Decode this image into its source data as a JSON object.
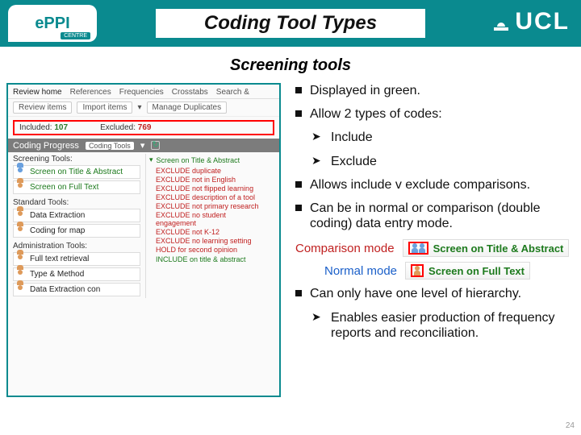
{
  "header": {
    "logo_text": "ePPI",
    "logo_sub": "CENTRE",
    "title": "Coding Tool Types",
    "ucl": "UCL"
  },
  "subtitle": "Screening tools",
  "screenshot": {
    "tabs": [
      "Review home",
      "References",
      "Frequencies",
      "Crosstabs",
      "Search &"
    ],
    "row2": {
      "t1": "Review items",
      "t2": "Import items",
      "t3": "Manage Duplicates"
    },
    "highlight": {
      "inc_label": "Included:",
      "inc_n": "107",
      "exc_label": "Excluded:",
      "exc_n": "769"
    },
    "section": {
      "title": "Coding Progress",
      "pill": "Coding Tools"
    },
    "groups": {
      "screening_label": "Screening Tools:",
      "screening": [
        "Screen on Title & Abstract",
        "Screen on Full Text"
      ],
      "standard_label": "Standard Tools:",
      "standard": [
        "Data Extraction",
        "Coding for map"
      ],
      "admin_label": "Administration Tools:",
      "admin": [
        "Full text retrieval",
        "Type & Method",
        "Data Extraction con"
      ]
    },
    "rightpanel": {
      "header": "Screen on Title & Abstract",
      "lines": [
        "EXCLUDE duplicate",
        "EXCLUDE not in English",
        "EXCLUDE not flipped learning",
        "EXCLUDE description of a tool",
        "EXCLUDE not primary research",
        "EXCLUDE no student engagement",
        "EXCLUDE not K-12",
        "EXCLUDE no learning setting",
        "HOLD for second opinion"
      ],
      "include_line": "INCLUDE on title & abstract"
    }
  },
  "points": {
    "p1": "Displayed in green.",
    "p2": "Allow 2 types of codes:",
    "p2a": "Include",
    "p2b": "Exclude",
    "p3": "Allows include v exclude comparisons.",
    "p4": "Can be in normal or comparison (double coding) data entry mode.",
    "p5": "Can only have one level of hierarchy.",
    "p5a": "Enables easier production of frequency reports and reconciliation."
  },
  "modes": {
    "cmp_label": "Comparison mode",
    "cmp_chip": "Screen on Title & Abstract",
    "norm_label": "Normal mode",
    "norm_chip": "Screen on Full Text"
  },
  "page_number": "24"
}
